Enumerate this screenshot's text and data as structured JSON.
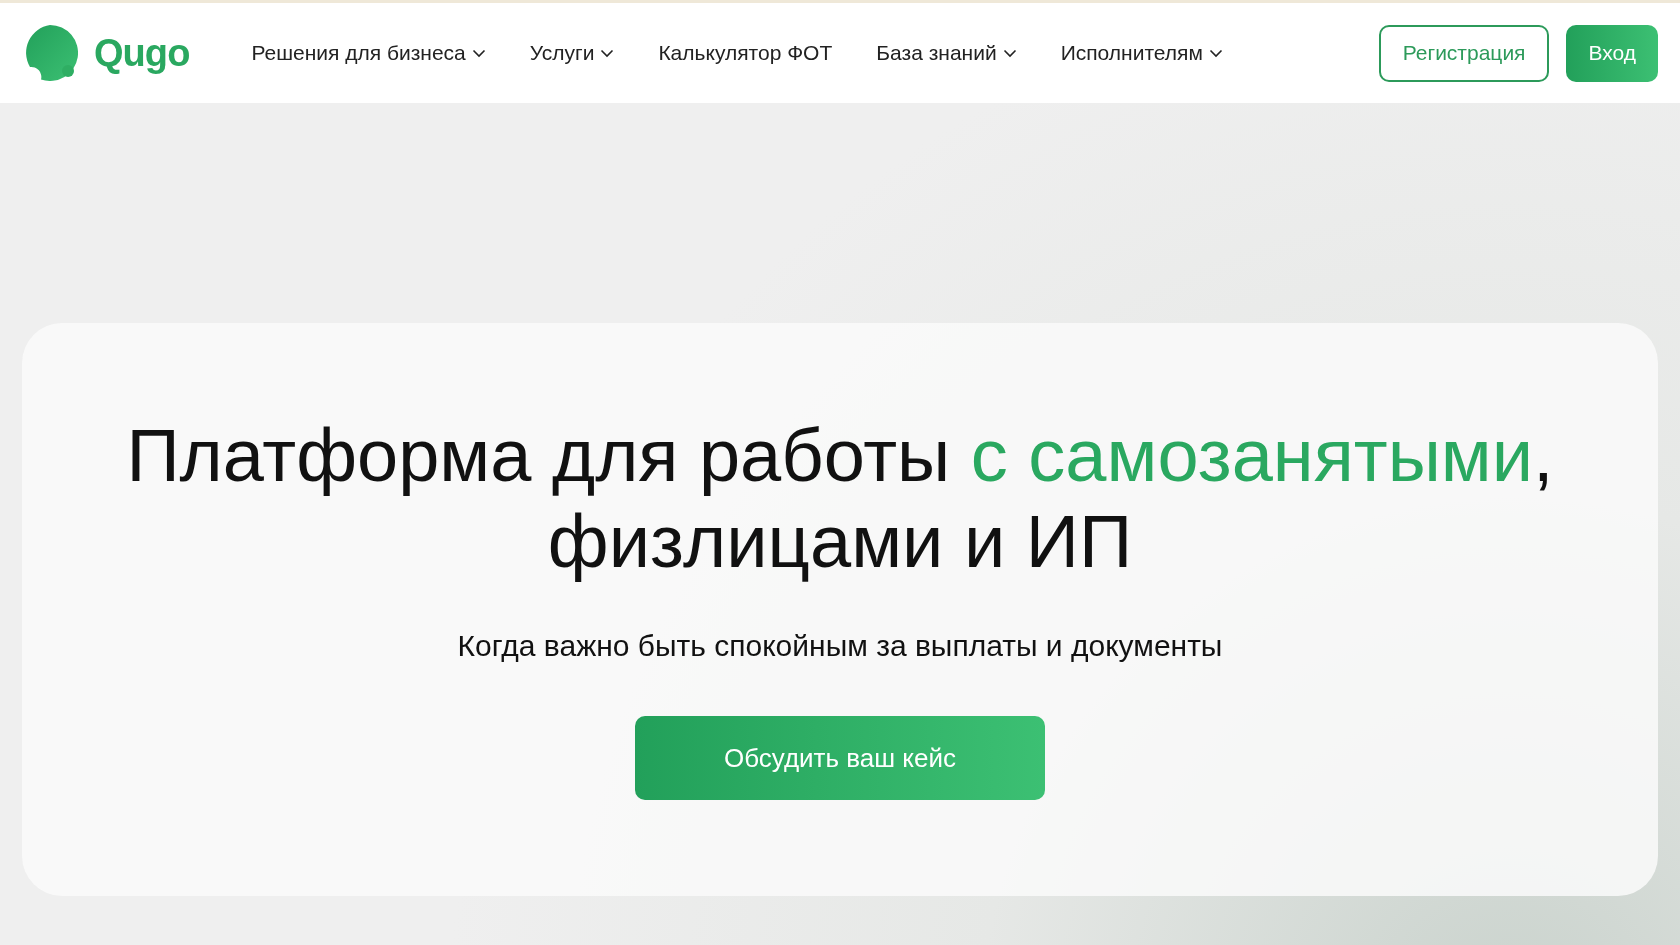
{
  "header": {
    "logo": "Qugo",
    "nav": [
      {
        "label": "Решения для бизнеса",
        "has_dropdown": true
      },
      {
        "label": "Услуги",
        "has_dropdown": true
      },
      {
        "label": "Калькулятор ФОТ",
        "has_dropdown": false
      },
      {
        "label": "База знаний",
        "has_dropdown": true
      },
      {
        "label": "Исполнителям",
        "has_dropdown": true
      }
    ],
    "buttons": [
      {
        "label": "Регистрация",
        "kind": "outline"
      },
      {
        "label": "Вход",
        "kind": "filled"
      }
    ]
  },
  "hero": {
    "title": [
      {
        "text": "Платформа для работы ",
        "accent": false
      },
      {
        "text": "с самозанятыми",
        "accent": true
      },
      {
        "text": ",",
        "accent": false
      },
      {
        "text": " физлицами и ИП",
        "accent": false
      }
    ],
    "subtitle": "Когда важно быть спокойным за выплаты и документы",
    "cta": "Обсудить ваш кейс"
  }
}
